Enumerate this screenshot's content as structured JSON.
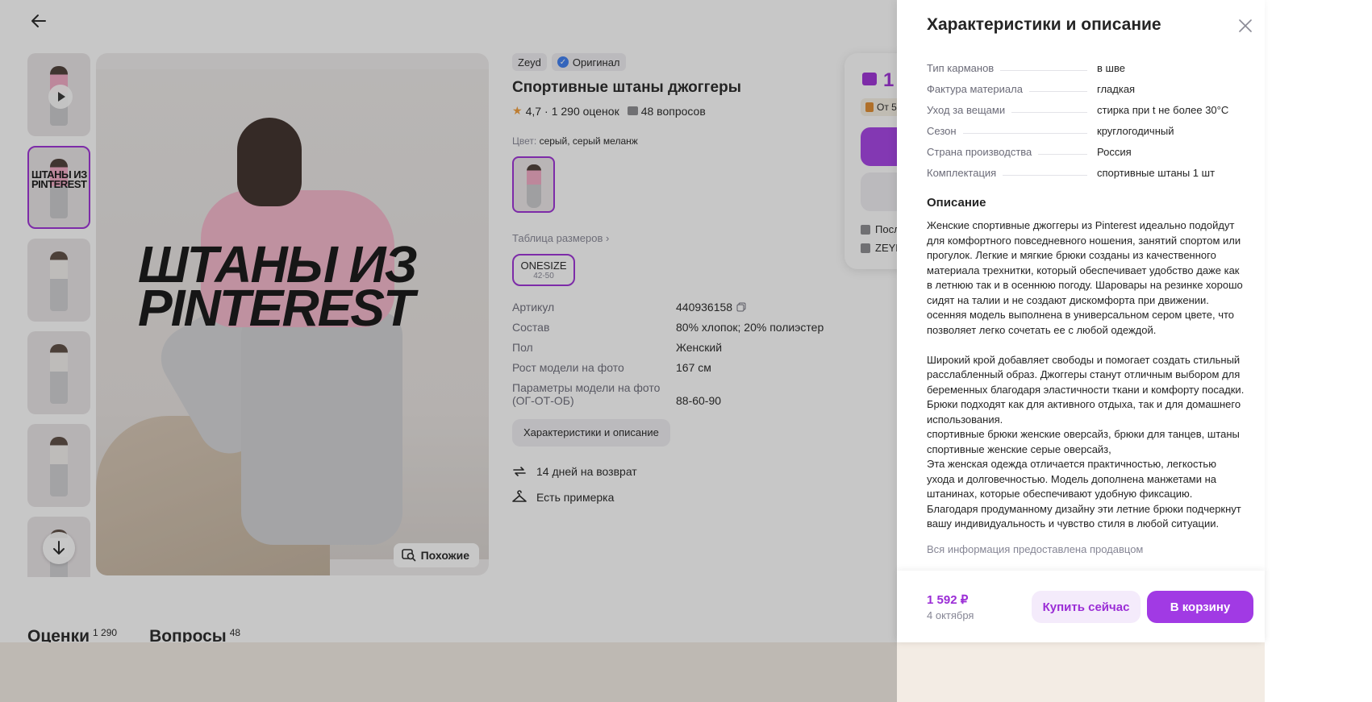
{
  "product": {
    "brand": "Zeyd",
    "original_label": "Оригинал",
    "title": "Спортивные штаны джоггеры",
    "rating": "4,7",
    "reviews": "1 290 оценок",
    "questions": "48 вопросов",
    "color_label": "Цвет:",
    "color_value": "серый, серый меланж",
    "size_table_link": "Таблица размеров",
    "size": "ONESIZE",
    "size_range": "42-50",
    "image_overlay_text": "ШТАНЫ ИЗ\nPINTEREST",
    "similar_button": "Похожие",
    "thumb_tag": "ШТАНЫ ИЗ PINTEREST",
    "specs": [
      {
        "key": "Артикул",
        "value": "440936158"
      },
      {
        "key": "Состав",
        "value": "80% хлопок; 20% полиэстер"
      },
      {
        "key": "Пол",
        "value": "Женский"
      },
      {
        "key": "Рост модели на фото",
        "value": "167 см"
      },
      {
        "key": "Параметры модели на фото (ОГ-ОТ-ОБ)",
        "value": "88-60-90"
      }
    ],
    "characteristics_button": "Характеристики и описание",
    "perks": [
      "14 дней на возврат",
      "Есть примерка"
    ]
  },
  "buybox": {
    "price_partial": "1",
    "promo_partial": "От 5",
    "row1": "Посл",
    "row2": "ZEYD"
  },
  "tabs": [
    {
      "label": "Оценки",
      "count": "1 290"
    },
    {
      "label": "Вопросы",
      "count": "48"
    }
  ],
  "drawer": {
    "title": "Характеристики и описание",
    "specs": [
      {
        "key": "Тип карманов",
        "value": "в шве"
      },
      {
        "key": "Фактура материала",
        "value": "гладкая"
      },
      {
        "key": "Уход за вещами",
        "value": "стирка при t не более 30°C"
      },
      {
        "key": "Сезон",
        "value": "круглогодичный"
      },
      {
        "key": "Страна производства",
        "value": "Россия"
      },
      {
        "key": "Комплектация",
        "value": "спортивные штаны 1 шт"
      }
    ],
    "description_title": "Описание",
    "description": "Женские спортивные джоггеры из Pinterest идеально подойдут для комфортного повседневного ношения, занятий спортом или прогулок. Легкие и мягкие брюки созданы из качественного материала трехнитки, который обеспечивает удобство даже как в летнюю так и в осеннюю погоду. Шаровары на резинке хорошо сидят на талии и не создают дискомфорта при движении. осенняя модель выполнена в универсальном сером цвете, что позволяет легко сочетать ее с любой одеждой.\n\nШирокий крой добавляет свободы и помогает создать стильный расслабленный образ. Джоггеры станут отличным выбором для беременных благодаря эластичности ткани и комфорту посадки. Брюки подходят как для активного отдыха, так и для домашнего использования.\nспортивные брюки женские оверсайз, брюки для танцев, штаны спортивные женские серые оверсайз,\nЭта женская одежда отличается практичностью, легкостью ухода и долговечностью. Модель дополнена манжетами на штанинах, которые обеспечивают удобную фиксацию. Благодаря продуманному дизайну эти летние брюки подчеркнут вашу индивидуальность и чувство стиля в любой ситуации.",
    "seller_note": "Вся информация предоставлена продавцом",
    "footer": {
      "price": "1 592 ₽",
      "delivery_date": "4 октября",
      "buy_now": "Купить сейчас",
      "to_cart": "В корзину"
    }
  },
  "colors": {
    "accent": "#a13ae4",
    "accent_text": "#9b2dd6",
    "muted_text": "#868695",
    "rating_star": "#f29b36"
  },
  "icons": [
    "arrow-left-icon",
    "play-icon",
    "arrow-down-icon",
    "search-similar-icon",
    "verified-icon",
    "star-icon",
    "question-icon",
    "copy-icon",
    "return-icon",
    "hanger-icon",
    "close-icon",
    "wallet-icon"
  ]
}
